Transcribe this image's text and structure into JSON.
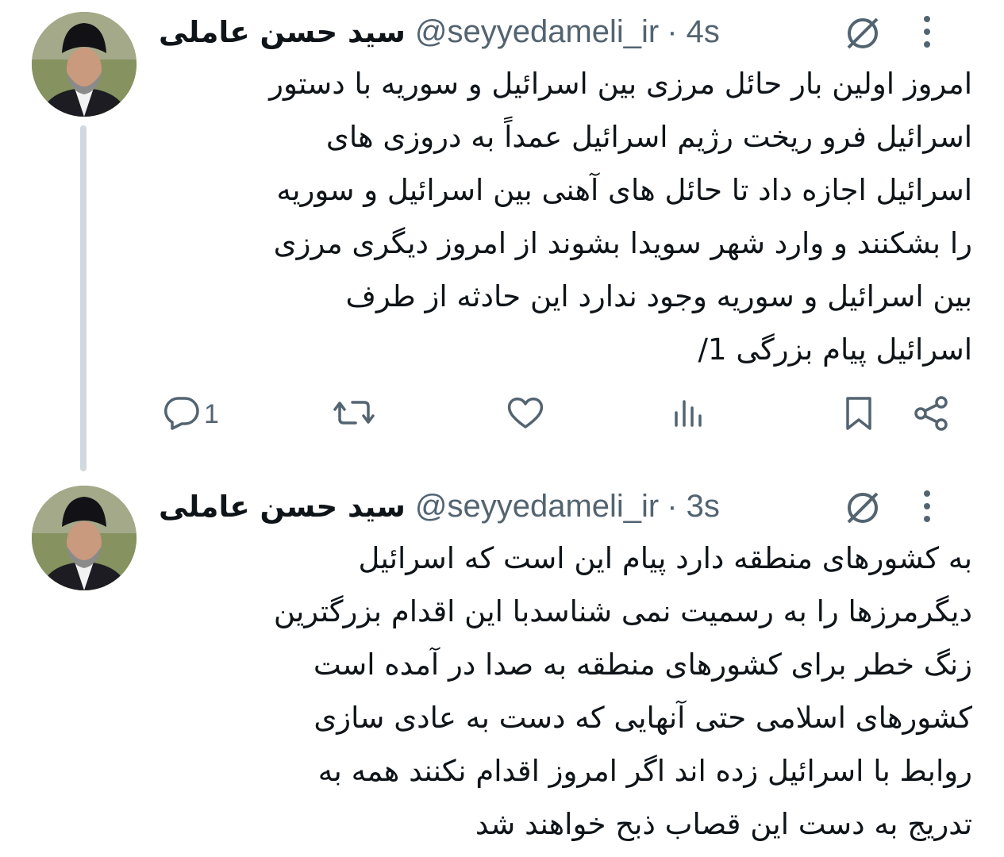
{
  "tweets": [
    {
      "author_name": "سید حسن عاملی",
      "handle": "@seyyedameli_ir",
      "time": "· 4s",
      "text_lines": [
        "امروز اولین بار حائل مرزی بین اسرائیل و سوریه با دستور",
        "اسرائیل فرو ریخت رژیم اسرائیل عمداً به دروزی های",
        "اسرائیل اجازه داد تا حائل های آهنی بین اسرائیل و سوریه",
        "را بشکنند و وارد شهر سویدا بشوند از امروز دیگری مرزی",
        "بین اسرائیل و سوریه وجود ندارد این حادثه از طرف",
        "اسرائیل پیام بزرگی 1/"
      ],
      "reply_count": "1"
    },
    {
      "author_name": "سید حسن عاملی",
      "handle": "@seyyedameli_ir",
      "time": "· 3s",
      "text_lines": [
        "به کشورهای منطقه دارد پیام این است که اسرائیل",
        "دیگرمرزها را به رسمیت نمی شناسدبا این اقدام بزرگترین",
        "زنگ خطر برای کشورهای منطقه به صدا در آمده است",
        "کشورهای اسلامی حتی آنهایی که دست به عادی سازی",
        "روابط با اسرائیل زده اند اگر امروز اقدام نکنند همه به",
        "تدریج به دست این قصاب ذبح خواهند شد"
      ]
    }
  ],
  "icons": {
    "grok": "grok-icon",
    "more": "more-icon",
    "reply": "reply-icon",
    "retweet": "retweet-icon",
    "like": "like-icon",
    "views": "views-icon",
    "bookmark": "bookmark-icon",
    "share": "share-icon"
  },
  "colors": {
    "text": "#0f1419",
    "secondary": "#536471",
    "thread_line": "#cfd9de"
  }
}
